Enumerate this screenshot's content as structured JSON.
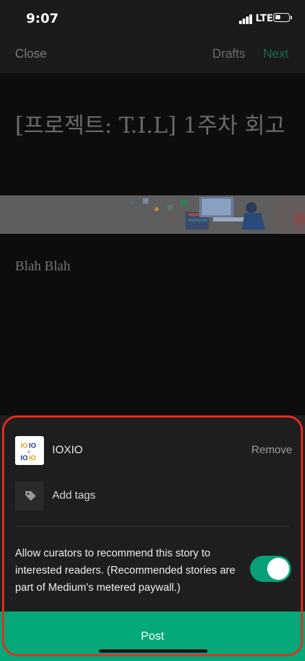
{
  "status_bar": {
    "time": "9:07",
    "network": "LTE"
  },
  "nav": {
    "close_label": "Close",
    "drafts_label": "Drafts",
    "next_label": "Next"
  },
  "story": {
    "title": "[프로젝트: T.I.L] 1주차 회고",
    "body": "Blah Blah"
  },
  "publication": {
    "logo_text": "IOXIO",
    "name": "IOXIO",
    "remove_label": "Remove"
  },
  "tags": {
    "add_label": "Add tags"
  },
  "curation": {
    "text": "Allow curators to recommend this story to interested readers. (Recommended stories are part of Medium's metered paywall.)",
    "enabled": true
  },
  "post_label": "Post",
  "colors": {
    "accent": "#05a878",
    "highlight": "#ea2c1a",
    "next": "#146b47"
  }
}
